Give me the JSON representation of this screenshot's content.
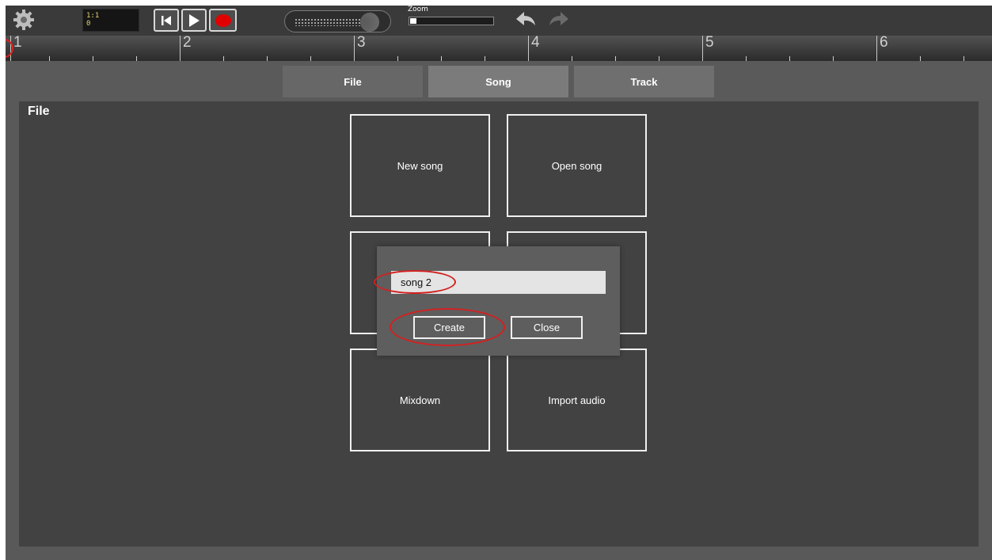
{
  "toolbar": {
    "settings_icon": "gear-icon",
    "position": {
      "bar_beat": "1:1",
      "tick": "0"
    },
    "transport": [
      {
        "name": "go-to-start-button",
        "icon": "skip-back-icon"
      },
      {
        "name": "play-button",
        "icon": "play-icon"
      },
      {
        "name": "record-button",
        "icon": "record-icon"
      }
    ],
    "zoom_label": "Zoom",
    "zoom_level": 0.05,
    "undo_icon": "undo-icon",
    "redo_icon": "redo-icon"
  },
  "ruler": {
    "bars": [
      "1",
      "2",
      "3",
      "4",
      "5",
      "6"
    ]
  },
  "tabs": [
    {
      "label": "File",
      "selected": false
    },
    {
      "label": "Song",
      "selected": true
    },
    {
      "label": "Track",
      "selected": false
    }
  ],
  "panel": {
    "title": "File",
    "tiles": [
      "New song",
      "Open song",
      "Mixdown",
      "Import audio"
    ]
  },
  "dialog": {
    "input_value": "song 2",
    "create_label": "Create",
    "close_label": "Close"
  },
  "colors": {
    "record": "#e00000",
    "highlight": "#d42020",
    "position_text": "#e6d36a"
  }
}
